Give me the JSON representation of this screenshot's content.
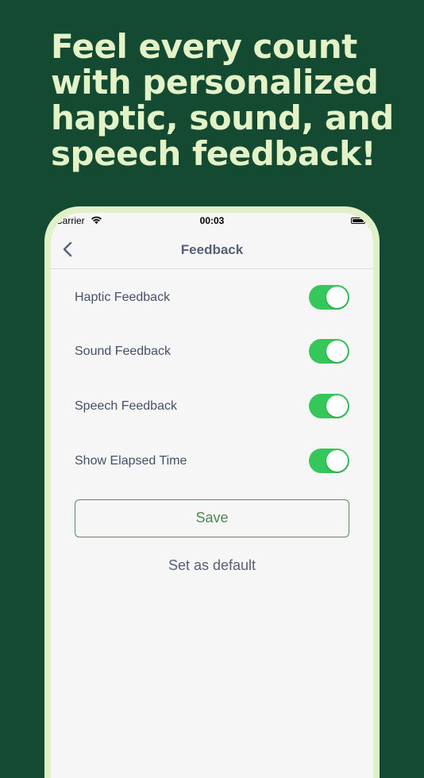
{
  "headline": {
    "line1": "Feel every count",
    "line2": "with personalized",
    "line3": "haptic, sound, and",
    "line4": "speech feedback!"
  },
  "status_bar": {
    "carrier": "Carrier",
    "time": "00:03",
    "wifi_icon": "wifi-icon",
    "battery_icon": "battery-icon"
  },
  "nav": {
    "title": "Feedback",
    "back_icon": "chevron-left-icon"
  },
  "settings": [
    {
      "label": "Haptic Feedback",
      "enabled": true
    },
    {
      "label": "Sound Feedback",
      "enabled": true
    },
    {
      "label": "Speech Feedback",
      "enabled": true
    },
    {
      "label": "Show Elapsed Time",
      "enabled": true
    }
  ],
  "actions": {
    "save_label": "Save",
    "default_label": "Set as default"
  },
  "colors": {
    "background": "#134a31",
    "headline": "#e4f3c7",
    "phone_frame": "#e1f1c7",
    "toggle_on": "#35c759",
    "save_border": "#5b8a5d"
  }
}
